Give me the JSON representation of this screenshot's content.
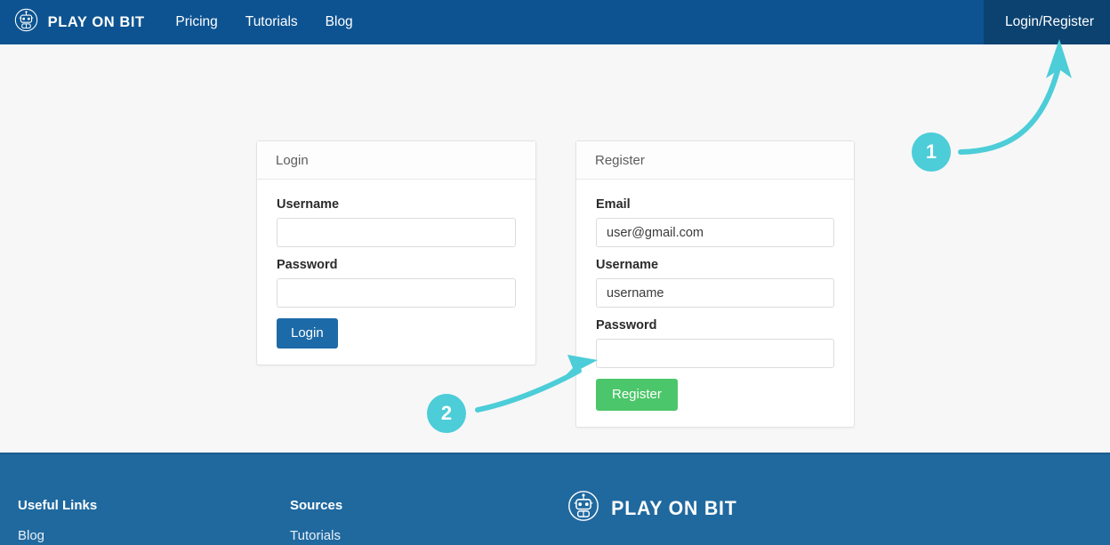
{
  "brand": {
    "name": "PLAY ON BIT",
    "logo_icon": "robot-head-icon"
  },
  "navbar": {
    "links": [
      {
        "label": "Pricing"
      },
      {
        "label": "Tutorials"
      },
      {
        "label": "Blog"
      }
    ],
    "auth_label": "Login/Register",
    "background_color": "#0d5391",
    "auth_background_color": "#0b4270"
  },
  "login_card": {
    "title": "Login",
    "username_label": "Username",
    "username_value": "",
    "username_placeholder": "",
    "password_label": "Password",
    "password_value": "",
    "password_placeholder": "",
    "submit_label": "Login",
    "submit_color": "#1d6aa8"
  },
  "register_card": {
    "title": "Register",
    "email_label": "Email",
    "email_value": "user@gmail.com",
    "email_placeholder": "user@gmail.com",
    "username_label": "Username",
    "username_value": "username",
    "username_placeholder": "username",
    "password_label": "Password",
    "password_value": "",
    "password_placeholder": "",
    "submit_label": "Register",
    "submit_color": "#4cc66a"
  },
  "annotations": {
    "accent_color": "#4ccdd8",
    "markers": [
      {
        "number": "1",
        "points_to": "Login/Register nav button"
      },
      {
        "number": "2",
        "points_to": "Register submit button"
      }
    ]
  },
  "footer": {
    "background_color": "#20699f",
    "columns": [
      {
        "heading": "Useful Links",
        "links": [
          {
            "label": "Blog"
          }
        ]
      },
      {
        "heading": "Sources",
        "links": [
          {
            "label": "Tutorials"
          }
        ]
      }
    ],
    "brand_name": "PLAY ON BIT"
  }
}
